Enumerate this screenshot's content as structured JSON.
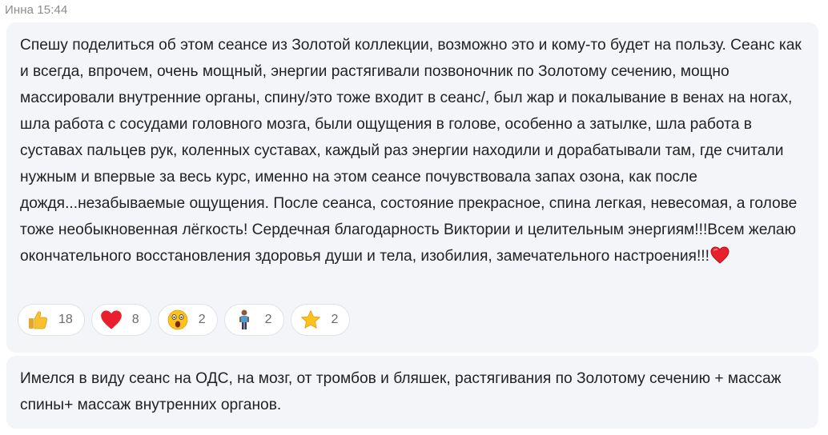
{
  "message1": {
    "author_time": "Инна 15:44",
    "text": "Спешу поделиться об этом сеансе из Золотой коллекции, возможно это и кому-то будет на пользу. Сеанс как и всегда, впрочем, очень мощный, энергии растягивали позвоночник по Золотому сечению, мощно массировали внутренние органы, спину/это тоже входит в сеанс/, был жар и покалывание в венах на ногах, шла работа с сосудами головного мозга, были ощущения в голове, особенно а затылке, шла работа в суставах пальцев рук, коленных суставах, каждый раз энергии находили и дорабатывали там, где считали нужным и впервые за весь курс, именно на этом сеансе почувствовала запах озона, как после дождя...незабываемые ощущения. После сеанса, состояние прекрасное, спина легкая, невесомая, а голове тоже необыкновенная лёгкость! Сердечная благодарность Виктории и целительным энергиям!!!Всем желаю окончательного восстановления здоровья души и тела, изобилия, замечательного настроения!!!",
    "trailing_emoji": "red-heart-icon",
    "reactions": [
      {
        "icon": "thumbs-up-icon",
        "count": "18"
      },
      {
        "icon": "red-heart-icon",
        "count": "8"
      },
      {
        "icon": "astonished-face-icon",
        "count": "2"
      },
      {
        "icon": "person-standing-icon",
        "count": "2"
      },
      {
        "icon": "star-icon",
        "count": "2"
      }
    ]
  },
  "message2": {
    "text": "Имелся в виду сеанс на ОДС, на мозг, от тромбов и бляшек, растягивания по Золотому сечению + массаж спины+ массаж внутренних органов."
  },
  "colors": {
    "bubble_bg": "#f3f5f8",
    "text": "#222222",
    "meta": "#8c8c8c",
    "reaction_border": "#dfe3ea"
  }
}
